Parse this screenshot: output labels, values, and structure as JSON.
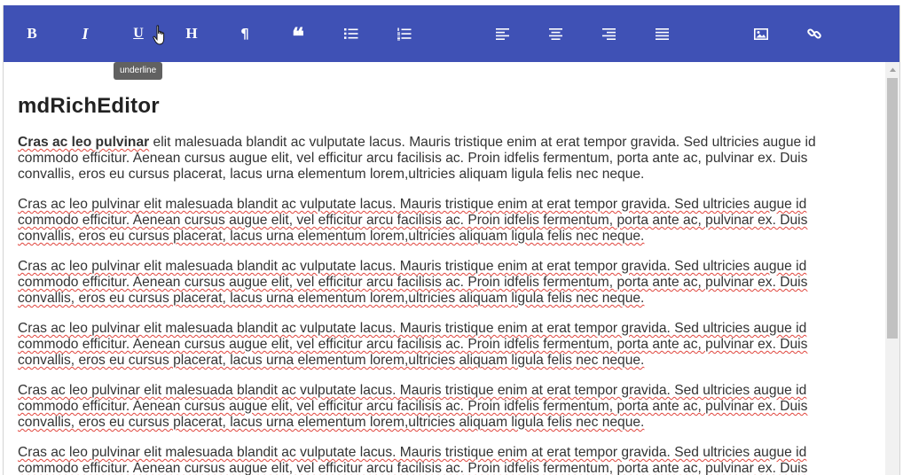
{
  "toolbar": {
    "accent_color": "#3f51b5",
    "buttons": [
      {
        "name": "bold-button",
        "icon": "bold-icon",
        "glyph": "B"
      },
      {
        "name": "italic-button",
        "icon": "italic-icon",
        "glyph": "I"
      },
      {
        "name": "underline-button",
        "icon": "underline-icon",
        "glyph": "U"
      },
      {
        "name": "heading-button",
        "icon": "heading-icon",
        "glyph": "H"
      },
      {
        "name": "paragraph-button",
        "icon": "paragraph-icon",
        "glyph": "¶"
      },
      {
        "name": "blockquote-button",
        "icon": "quote-icon",
        "glyph": "❝"
      },
      {
        "name": "bulleted-list-button",
        "icon": "bulleted-list-icon"
      },
      {
        "name": "numbered-list-button",
        "icon": "numbered-list-icon"
      },
      {
        "name": "align-left-button",
        "icon": "align-left-icon"
      },
      {
        "name": "align-center-button",
        "icon": "align-center-icon"
      },
      {
        "name": "align-right-button",
        "icon": "align-right-icon"
      },
      {
        "name": "align-justify-button",
        "icon": "align-justify-icon"
      },
      {
        "name": "insert-image-button",
        "icon": "image-icon"
      },
      {
        "name": "insert-link-button",
        "icon": "link-icon"
      }
    ]
  },
  "tooltip": {
    "text": "underline"
  },
  "editor": {
    "title": "mdRichEditor",
    "first_paragraph": {
      "bold_lead": "Cras ac leo pulvinar",
      "rest": " elit malesuada blandit ac vulputate lacus. Mauris tristique enim at erat tempor gravida. Sed ultricies augue id commodo efficitur. Aenean cursus augue elit, vel efficitur arcu facilisis ac. Proin idfelis fermentum, porta ante ac, pulvinar ex. Duis convallis, eros eu cursus placerat, lacus urna elementum lorem,ultricies aliquam ligula felis nec neque."
    },
    "repeated_paragraph": "Cras ac leo pulvinar elit malesuada blandit ac vulputate lacus. Mauris tristique enim at erat tempor gravida. Sed ultricies augue id commodo efficitur. Aenean cursus augue elit, vel efficitur arcu facilisis ac. Proin idfelis fermentum, porta ante ac, pulvinar ex. Duis convallis, eros eu cursus placerat, lacus urna elementum lorem,ultricies aliquam ligula felis nec neque."
  }
}
